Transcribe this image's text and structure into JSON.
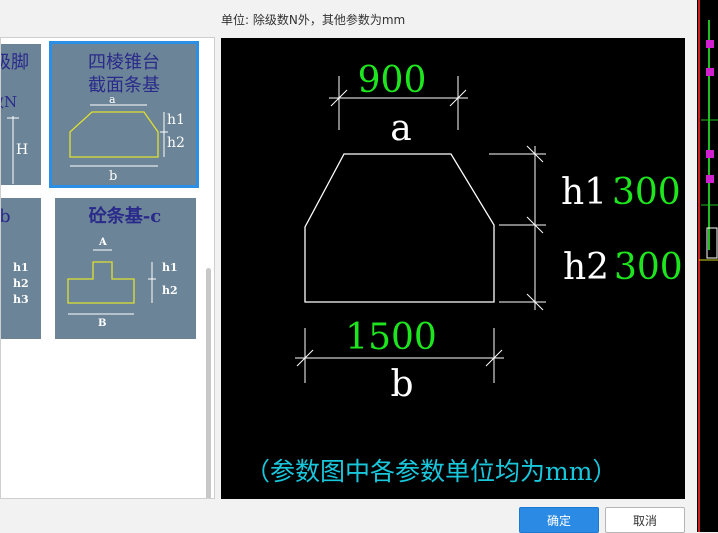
{
  "unit_note": "单位:   除级数N外，其他参数为mm",
  "gallery": {
    "cards": [
      {
        "title_l1": "级脚",
        "label_n": "数N",
        "label_h": "H"
      },
      {
        "title_l1": "四棱锥台",
        "title_l2": "截面条基",
        "label_a": "a",
        "label_b": "b",
        "label_h1": "h1",
        "label_h2": "h2"
      },
      {
        "title": "-b",
        "label_h1": "h1",
        "label_h2": "h2",
        "label_h3": "h3"
      },
      {
        "title": "砼条基-c",
        "label_a": "A",
        "label_b": "B",
        "label_h1": "h1",
        "label_h2": "h2"
      }
    ]
  },
  "preview": {
    "a_value": "900",
    "a_label": "a",
    "h1_label": "h1",
    "h1_value": "300",
    "h2_label": "h2",
    "h2_value": "300",
    "b_value": "1500",
    "b_label": "b",
    "footer_note": "（参数图中各参数单位均为mm）"
  },
  "buttons": {
    "ok": "确定",
    "cancel": "取消"
  },
  "colors": {
    "accent": "#2a8ae4",
    "selected_outline": "#2b8fe6",
    "dim_value": "#1ee61e",
    "footer_note": "#19c7dc"
  }
}
